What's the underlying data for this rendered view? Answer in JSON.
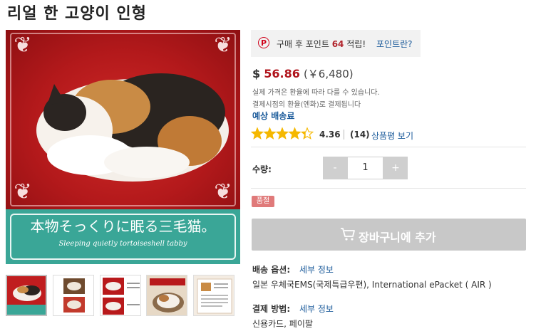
{
  "product": {
    "title": "리얼 한 고양이 인형",
    "image_caption_jp": "本物そっくりに眠る三毛猫。",
    "image_caption_en": "Sleeping quietly tortoiseshell tabby"
  },
  "points": {
    "prefix": "구매 후 포인트",
    "amount": "64",
    "suffix": "적립!",
    "link": "포인트란?",
    "icon": "P"
  },
  "price": {
    "currency_symbol": "$",
    "usd": "56.86",
    "jpy": "(￥6,480)",
    "note1": "실제 가격은 환율에 따라 다를 수 있습니다.",
    "note2": "결제시점의 환율(엔화)로 결제됩니다",
    "shipping_estimate": "예상 배송료"
  },
  "rating": {
    "value": 4.36,
    "value_text": "4.36",
    "count": "(14)",
    "review_link": "상품평 보기"
  },
  "quantity": {
    "label": "수량:",
    "minus": "-",
    "plus": "+",
    "value": "1"
  },
  "status_badge": "품절",
  "cart_button": "장바구니에 추가",
  "shipping": {
    "label": "배송 옵션:",
    "link": "세부 정보",
    "value": "일본 우체국EMS(국제특급우편), International ePacket ( AIR )"
  },
  "payment": {
    "label": "결제 방법:",
    "link": "세부 정보",
    "value": "신용카드, 페이팔"
  },
  "colors": {
    "accent_red": "#b0141c",
    "link_blue": "#1a5a9a",
    "disabled_gray": "#c8c8c8",
    "soldout_red": "#e07a7a"
  }
}
